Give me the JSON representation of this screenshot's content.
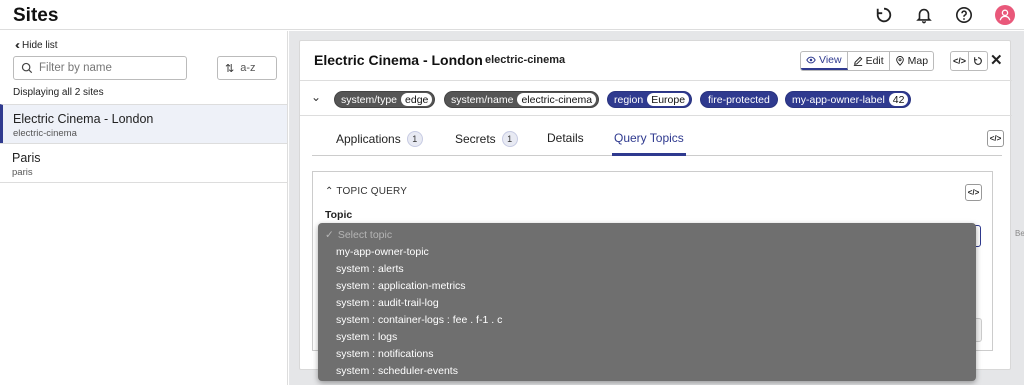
{
  "app": {
    "title": "Sites"
  },
  "sidebar": {
    "hide_list_label": "Hide list",
    "filter_placeholder": "Filter by name",
    "sort_label": "a-z",
    "displaying_text": "Displaying all 2 sites",
    "sites": [
      {
        "name": "Electric Cinema - London",
        "slug": "electric-cinema"
      },
      {
        "name": "Paris",
        "slug": "paris"
      }
    ]
  },
  "detail": {
    "title": "Electric Cinema - London",
    "slug": "electric-cinema",
    "view_buttons": [
      "View",
      "Edit",
      "Map"
    ],
    "code_button": "</>",
    "labels": [
      {
        "key": "system/type",
        "value": "edge",
        "style": "grey"
      },
      {
        "key": "system/name",
        "value": "electric-cinema",
        "style": "grey"
      },
      {
        "key": "region",
        "value": "Europe",
        "style": "blue"
      },
      {
        "key": "fire-protected",
        "value": "",
        "style": "blue"
      },
      {
        "key": "my-app-owner-label",
        "value": "42",
        "style": "blue"
      }
    ],
    "tabs": [
      {
        "label": "Applications",
        "count": "1"
      },
      {
        "label": "Secrets",
        "count": "1"
      },
      {
        "label": "Details",
        "count": ""
      },
      {
        "label": "Query Topics",
        "count": ""
      }
    ],
    "active_tab": "Query Topics",
    "query_section_title": "TOPIC QUERY",
    "topic_label": "Topic"
  },
  "dropdown": {
    "selected_placeholder": "Select topic",
    "options": [
      "my-app-owner-topic",
      "system : alerts",
      "system : application-metrics",
      "system : audit-trail-log",
      "system : container-logs : fee . f-1 . c",
      "system : logs",
      "system : notifications",
      "system : scheduler-events"
    ]
  },
  "map": {
    "edge_label": "Be"
  },
  "colors": {
    "accent": "#2f3a8f",
    "chip_grey": "#555555",
    "avatar": "#e9587a",
    "dropdown_bg": "#6f6f6f"
  }
}
